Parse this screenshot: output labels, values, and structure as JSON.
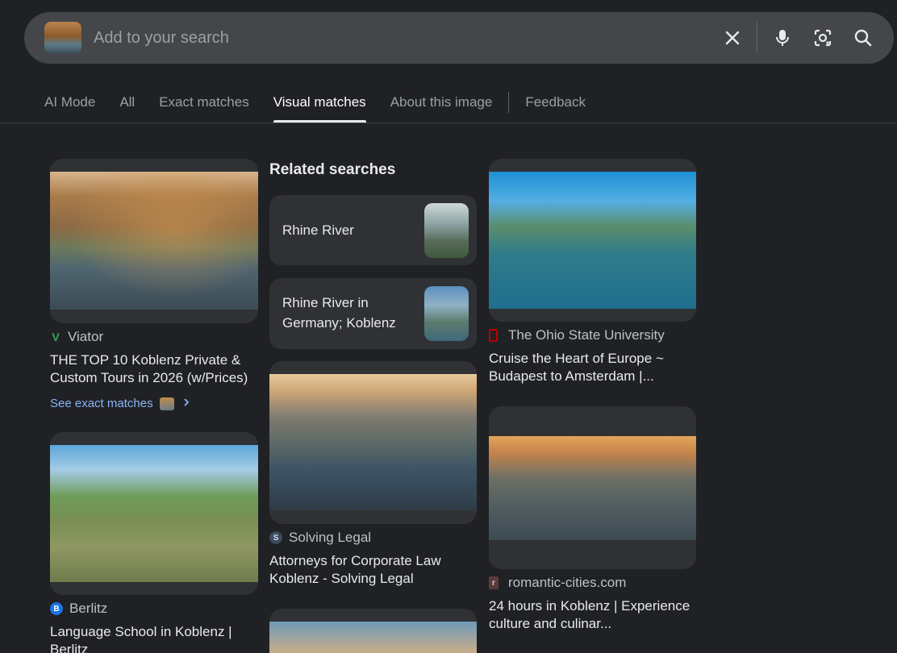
{
  "search": {
    "placeholder": "Add to your search",
    "clear_icon": "close-icon",
    "voice_icon": "mic-icon",
    "lens_icon": "lens-icon",
    "search_icon": "search-icon"
  },
  "tabs": [
    {
      "label": "AI Mode"
    },
    {
      "label": "All"
    },
    {
      "label": "Exact matches"
    },
    {
      "label": "Visual matches",
      "active": true
    },
    {
      "label": "About this image"
    },
    {
      "label": "Feedback"
    }
  ],
  "results": {
    "col1": [
      {
        "source": "Viator",
        "title": "THE TOP 10 Koblenz Private & Custom Tours in 2026 (w/Prices)",
        "see_exact": "See exact matches"
      },
      {
        "source": "Berlitz",
        "title": "Language School in Koblenz | Berlitz"
      }
    ],
    "col2": [
      {
        "source": "Solving Legal",
        "title": "Attorneys for Corporate Law Koblenz - Solving Legal"
      }
    ],
    "col3": [
      {
        "source": "The Ohio State University",
        "title": "Cruise the Heart of Europe ~ Budapest to Amsterdam |..."
      },
      {
        "source": "romantic-cities.com",
        "title": "24 hours in Koblenz | Experience culture and culinar..."
      }
    ]
  },
  "related": {
    "heading": "Related searches",
    "items": [
      {
        "label": "Rhine River"
      },
      {
        "label": "Rhine River in Germany; Koblenz"
      }
    ]
  },
  "colors": {
    "background": "#202124",
    "link": "#8ab4f8",
    "viator": "#34a853",
    "berlitz": "#1a73e8",
    "osu": "#bb0000"
  }
}
